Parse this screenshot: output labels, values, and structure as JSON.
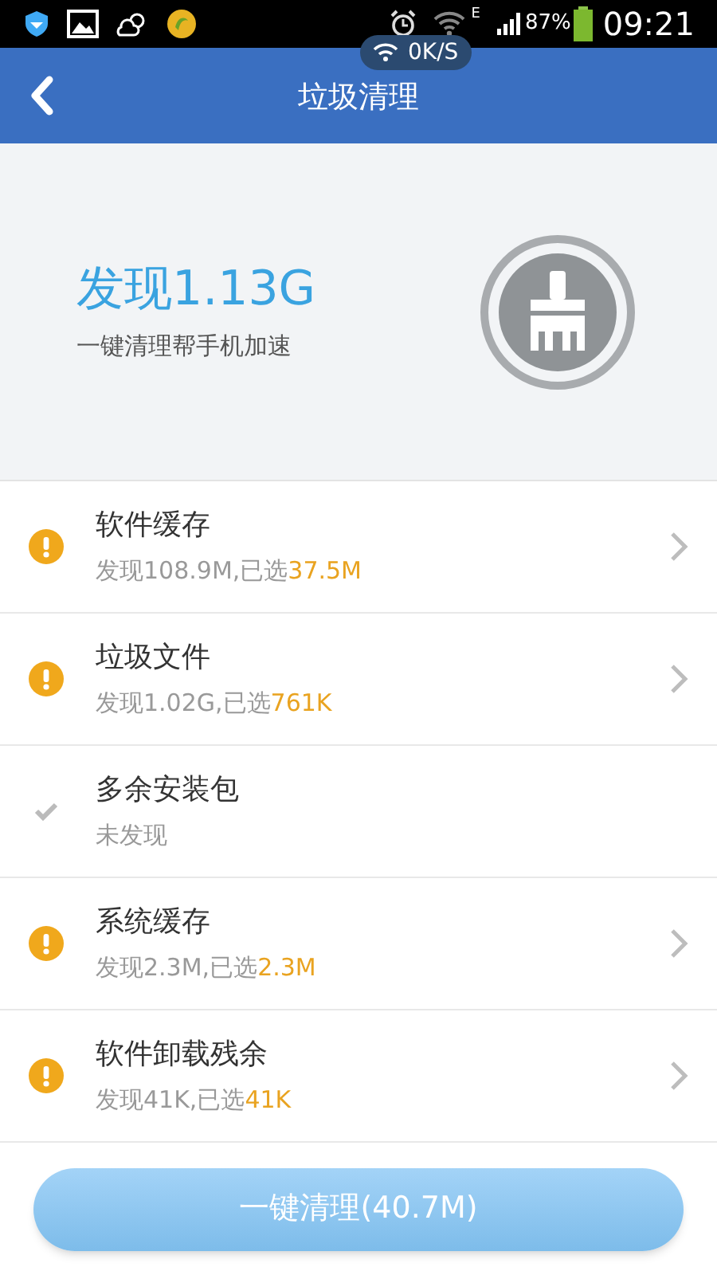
{
  "status_bar": {
    "network_type": "E",
    "battery": "87%",
    "time": "09:21"
  },
  "speed_overlay": {
    "text": "0K/S"
  },
  "header": {
    "title": "垃圾清理"
  },
  "summary": {
    "headline": "发现1.13G",
    "subtitle": "一键清理帮手机加速"
  },
  "items": [
    {
      "kind": "warning",
      "title": "软件缓存",
      "detail": "发现108.9M,已选",
      "selected_size": "37.5M"
    },
    {
      "kind": "warning",
      "title": "垃圾文件",
      "detail": "发现1.02G,已选",
      "selected_size": "761K"
    },
    {
      "kind": "done",
      "title": "多余安装包",
      "detail": "未发现"
    },
    {
      "kind": "warning",
      "title": "系统缓存",
      "detail": "发现2.3M,已选",
      "selected_size": "2.3M"
    },
    {
      "kind": "warning",
      "title": "软件卸载残余",
      "detail": "发现41K,已选",
      "selected_size": "41K"
    }
  ],
  "clean_button": {
    "label": "一键清理(40.7M)"
  }
}
